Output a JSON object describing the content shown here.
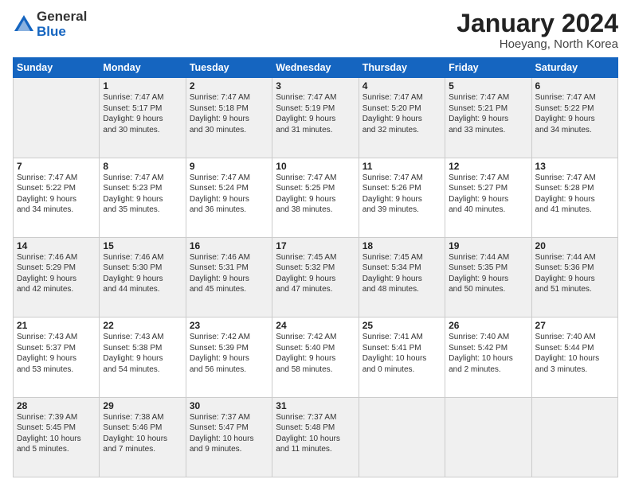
{
  "logo": {
    "general": "General",
    "blue": "Blue"
  },
  "title": "January 2024",
  "location": "Hoeyang, North Korea",
  "days": [
    "Sunday",
    "Monday",
    "Tuesday",
    "Wednesday",
    "Thursday",
    "Friday",
    "Saturday"
  ],
  "weeks": [
    [
      {
        "day": "",
        "text": ""
      },
      {
        "day": "1",
        "text": "Sunrise: 7:47 AM\nSunset: 5:17 PM\nDaylight: 9 hours\nand 30 minutes."
      },
      {
        "day": "2",
        "text": "Sunrise: 7:47 AM\nSunset: 5:18 PM\nDaylight: 9 hours\nand 30 minutes."
      },
      {
        "day": "3",
        "text": "Sunrise: 7:47 AM\nSunset: 5:19 PM\nDaylight: 9 hours\nand 31 minutes."
      },
      {
        "day": "4",
        "text": "Sunrise: 7:47 AM\nSunset: 5:20 PM\nDaylight: 9 hours\nand 32 minutes."
      },
      {
        "day": "5",
        "text": "Sunrise: 7:47 AM\nSunset: 5:21 PM\nDaylight: 9 hours\nand 33 minutes."
      },
      {
        "day": "6",
        "text": "Sunrise: 7:47 AM\nSunset: 5:22 PM\nDaylight: 9 hours\nand 34 minutes."
      }
    ],
    [
      {
        "day": "7",
        "text": "Sunrise: 7:47 AM\nSunset: 5:22 PM\nDaylight: 9 hours\nand 34 minutes."
      },
      {
        "day": "8",
        "text": "Sunrise: 7:47 AM\nSunset: 5:23 PM\nDaylight: 9 hours\nand 35 minutes."
      },
      {
        "day": "9",
        "text": "Sunrise: 7:47 AM\nSunset: 5:24 PM\nDaylight: 9 hours\nand 36 minutes."
      },
      {
        "day": "10",
        "text": "Sunrise: 7:47 AM\nSunset: 5:25 PM\nDaylight: 9 hours\nand 38 minutes."
      },
      {
        "day": "11",
        "text": "Sunrise: 7:47 AM\nSunset: 5:26 PM\nDaylight: 9 hours\nand 39 minutes."
      },
      {
        "day": "12",
        "text": "Sunrise: 7:47 AM\nSunset: 5:27 PM\nDaylight: 9 hours\nand 40 minutes."
      },
      {
        "day": "13",
        "text": "Sunrise: 7:47 AM\nSunset: 5:28 PM\nDaylight: 9 hours\nand 41 minutes."
      }
    ],
    [
      {
        "day": "14",
        "text": "Sunrise: 7:46 AM\nSunset: 5:29 PM\nDaylight: 9 hours\nand 42 minutes."
      },
      {
        "day": "15",
        "text": "Sunrise: 7:46 AM\nSunset: 5:30 PM\nDaylight: 9 hours\nand 44 minutes."
      },
      {
        "day": "16",
        "text": "Sunrise: 7:46 AM\nSunset: 5:31 PM\nDaylight: 9 hours\nand 45 minutes."
      },
      {
        "day": "17",
        "text": "Sunrise: 7:45 AM\nSunset: 5:32 PM\nDaylight: 9 hours\nand 47 minutes."
      },
      {
        "day": "18",
        "text": "Sunrise: 7:45 AM\nSunset: 5:34 PM\nDaylight: 9 hours\nand 48 minutes."
      },
      {
        "day": "19",
        "text": "Sunrise: 7:44 AM\nSunset: 5:35 PM\nDaylight: 9 hours\nand 50 minutes."
      },
      {
        "day": "20",
        "text": "Sunrise: 7:44 AM\nSunset: 5:36 PM\nDaylight: 9 hours\nand 51 minutes."
      }
    ],
    [
      {
        "day": "21",
        "text": "Sunrise: 7:43 AM\nSunset: 5:37 PM\nDaylight: 9 hours\nand 53 minutes."
      },
      {
        "day": "22",
        "text": "Sunrise: 7:43 AM\nSunset: 5:38 PM\nDaylight: 9 hours\nand 54 minutes."
      },
      {
        "day": "23",
        "text": "Sunrise: 7:42 AM\nSunset: 5:39 PM\nDaylight: 9 hours\nand 56 minutes."
      },
      {
        "day": "24",
        "text": "Sunrise: 7:42 AM\nSunset: 5:40 PM\nDaylight: 9 hours\nand 58 minutes."
      },
      {
        "day": "25",
        "text": "Sunrise: 7:41 AM\nSunset: 5:41 PM\nDaylight: 10 hours\nand 0 minutes."
      },
      {
        "day": "26",
        "text": "Sunrise: 7:40 AM\nSunset: 5:42 PM\nDaylight: 10 hours\nand 2 minutes."
      },
      {
        "day": "27",
        "text": "Sunrise: 7:40 AM\nSunset: 5:44 PM\nDaylight: 10 hours\nand 3 minutes."
      }
    ],
    [
      {
        "day": "28",
        "text": "Sunrise: 7:39 AM\nSunset: 5:45 PM\nDaylight: 10 hours\nand 5 minutes."
      },
      {
        "day": "29",
        "text": "Sunrise: 7:38 AM\nSunset: 5:46 PM\nDaylight: 10 hours\nand 7 minutes."
      },
      {
        "day": "30",
        "text": "Sunrise: 7:37 AM\nSunset: 5:47 PM\nDaylight: 10 hours\nand 9 minutes."
      },
      {
        "day": "31",
        "text": "Sunrise: 7:37 AM\nSunset: 5:48 PM\nDaylight: 10 hours\nand 11 minutes."
      },
      {
        "day": "",
        "text": ""
      },
      {
        "day": "",
        "text": ""
      },
      {
        "day": "",
        "text": ""
      }
    ]
  ]
}
